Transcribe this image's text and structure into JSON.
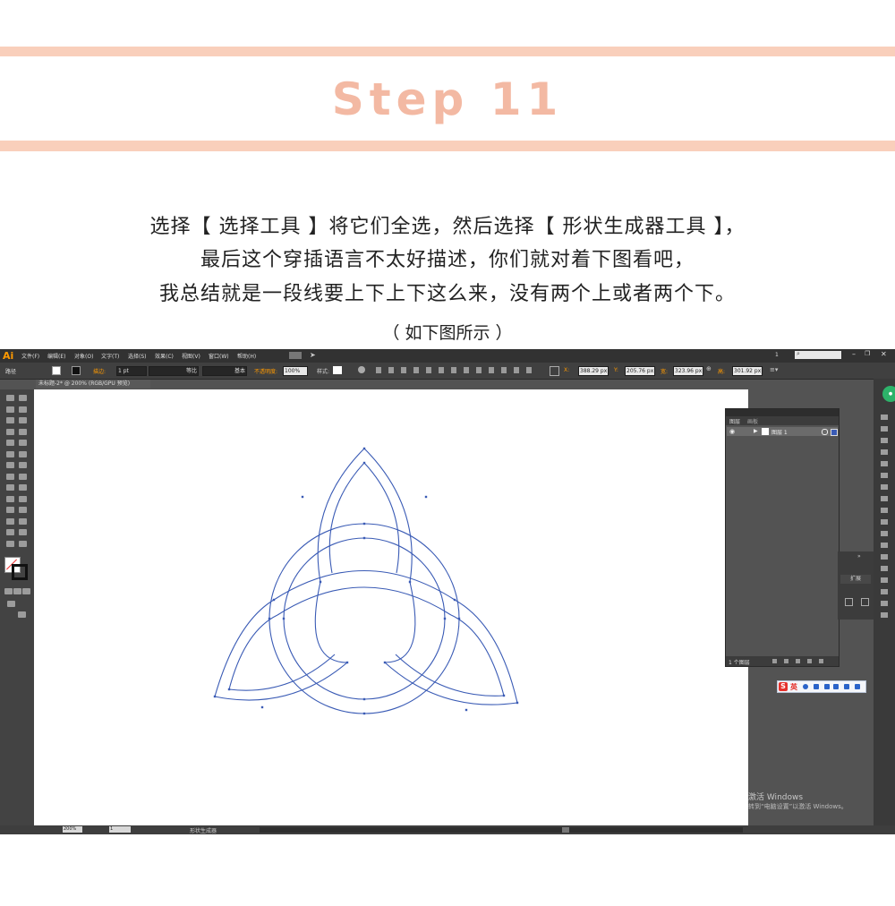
{
  "header": {
    "title": "Step 11"
  },
  "description": {
    "line1": "选择【 选择工具 】将它们全选，然后选择【 形状生成器工具 】，",
    "line2": "最后这个穿插语言不太好描述，你们就对着下图看吧，",
    "line3": "我总结就是一段线要上下上下这么来，没有两个上或者两个下。",
    "caption": "（ 如下图所示 ）"
  },
  "illustrator": {
    "logo": "Ai",
    "menu": [
      "文件(F)",
      "编辑(E)",
      "对象(O)",
      "文字(T)",
      "选择(S)",
      "效果(C)",
      "视图(V)",
      "窗口(W)",
      "帮助(H)"
    ],
    "search_placeholder": "",
    "page_indicator": "1",
    "control_bar": {
      "selection_label": "路径",
      "stroke_label": "描边:",
      "stroke_value": "1 pt",
      "profile_label": "等比",
      "brush_label": "基本",
      "opacity_label": "不透明度:",
      "opacity_value": "100%",
      "style_label": "样式:",
      "x_label": "X:",
      "x_value": "388.29 px",
      "y_label": "Y:",
      "y_value": "205.76 px",
      "w_label": "宽:",
      "w_value": "323.96 px",
      "h_label": "高:",
      "h_value": "301.92 px"
    },
    "document_tab": "未标题-2* @ 200% (RGB/GPU 预览)",
    "layers_panel": {
      "tab_layers": "图层",
      "tab_artboards": "画板",
      "layer_name": "图层 1",
      "footer": "1 个图层"
    },
    "properties_panel": {
      "expand_button": "扩展"
    },
    "ime": {
      "lang": "英"
    },
    "windows_activation": {
      "line1": "激活 Windows",
      "line2": "转到“电脑设置”以激活 Windows。"
    },
    "status_bar": {
      "zoom": "200%",
      "artboard": "1",
      "tool_name": "形状生成器"
    },
    "colors": {
      "accent_band": "#f9cfbb",
      "title_color": "#f3b9a3",
      "path_color": "#3a5bb5",
      "ui_dark": "#535353"
    }
  }
}
